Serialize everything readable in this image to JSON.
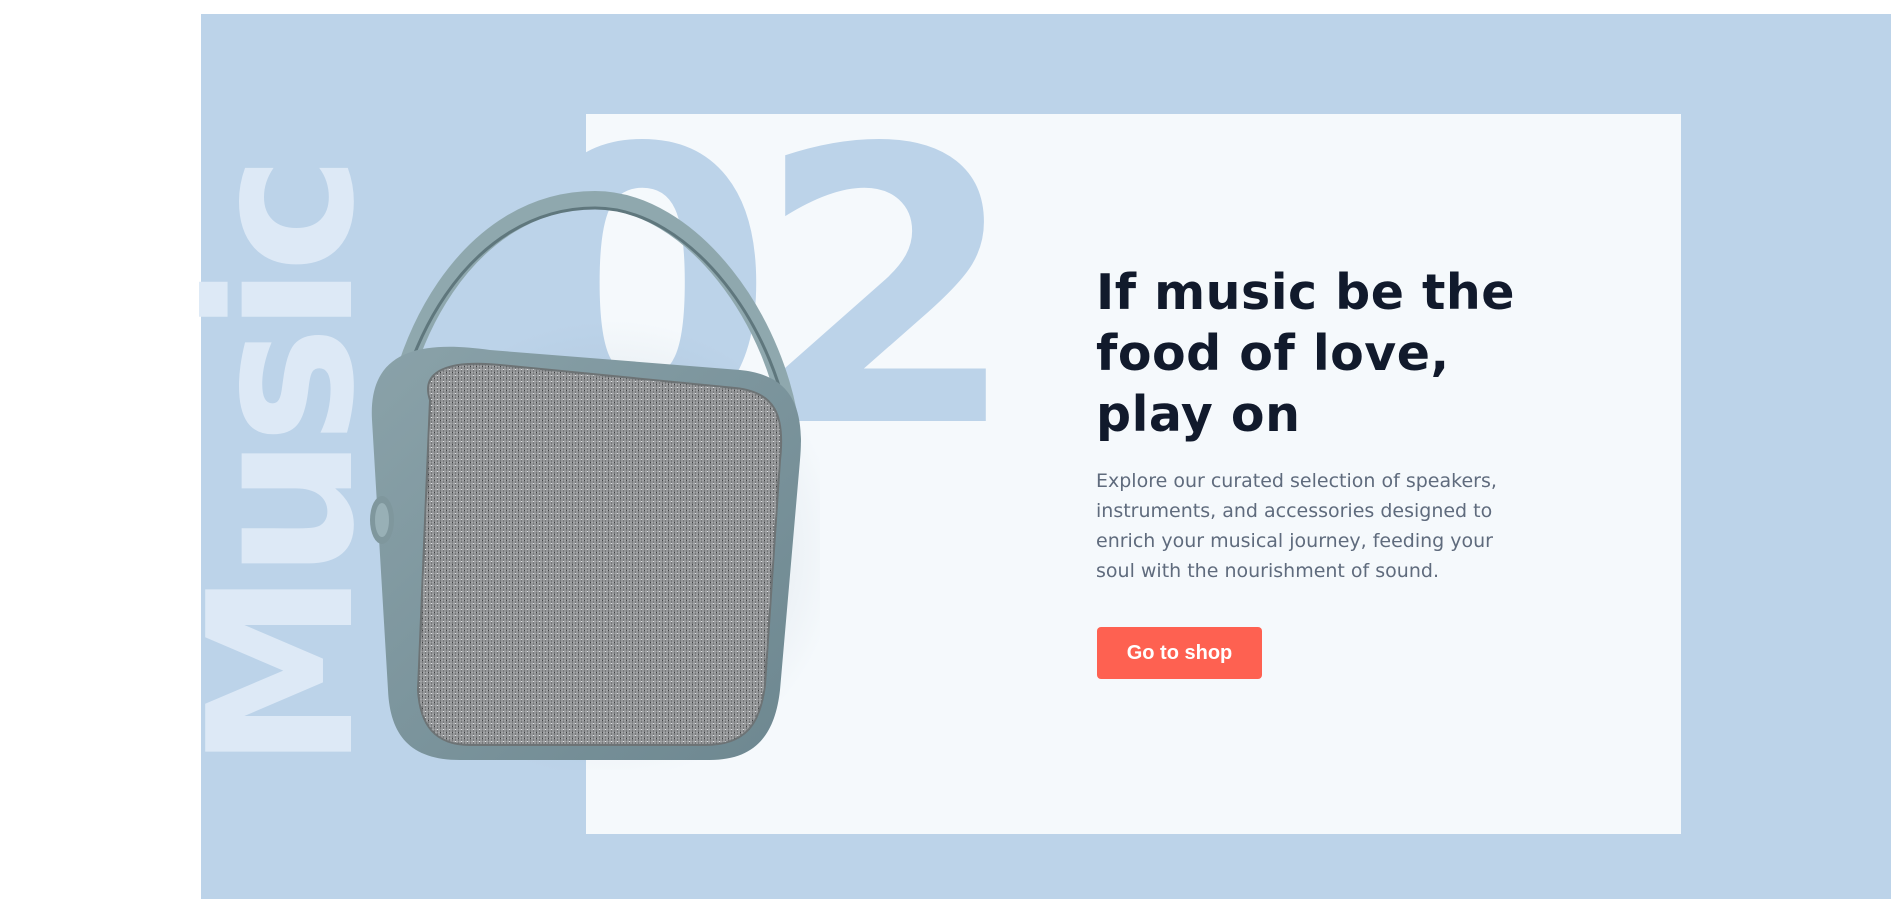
{
  "hero": {
    "vertical_word": "Music",
    "slide_number": "02",
    "headline_lines": [
      "If music be the",
      "food of love,",
      "play on"
    ],
    "description_lines": [
      "Explore our curated selection of speakers,",
      "instruments, and accessories designed to",
      "enrich your musical journey, feeding your",
      "soul with the nourishment of sound."
    ],
    "cta_label": "Go to shop"
  },
  "product_image": {
    "subject": "portable fabric speaker with carrying handle",
    "icon": "speaker-icon"
  },
  "colors": {
    "hero_background": "#bcd3e9",
    "card_background": "#f5f9fc",
    "headline": "#111a2c",
    "body_text": "#5f6b7d",
    "accent_button": "#fe6151",
    "watermark_text": "#dde9f6"
  }
}
